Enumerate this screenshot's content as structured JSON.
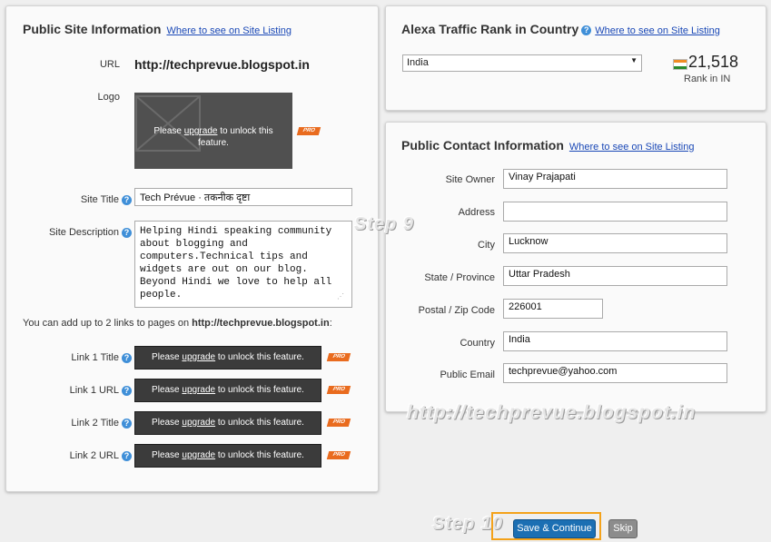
{
  "public_site": {
    "title": "Public Site Information",
    "where_link": "Where to see on Site Listing",
    "url_label": "URL",
    "url_value": "http://techprevue.blogspot.in",
    "logo_label": "Logo",
    "logo_lock_text": "Please upgrade to unlock this feature.",
    "logo_lock_pre": "Please ",
    "logo_lock_link": "upgrade",
    "logo_lock_post": " to unlock this feature.",
    "site_title_label": "Site Title",
    "site_title_value": "Tech Prévue · तकनीक दृष्टा",
    "site_desc_label": "Site Description",
    "site_desc_value": "Helping Hindi speaking community about blogging and computers.Technical tips and widgets are out on our blog. Beyond Hindi we love to help all people.",
    "links_note_pre": "You can add up to 2 links to pages on ",
    "links_note_url": "http://techprevue.blogspot.in",
    "links_note_post": ":",
    "links": [
      {
        "label": "Link 1 Title"
      },
      {
        "label": "Link 1 URL"
      },
      {
        "label": "Link 2 Title"
      },
      {
        "label": "Link 2 URL"
      }
    ],
    "lock_pre": "Please ",
    "lock_link": "upgrade",
    "lock_post": " to unlock this feature.",
    "pro_badge": "PRO"
  },
  "alexa": {
    "title": "Alexa Traffic Rank in Country",
    "where_link": "Where to see on Site Listing",
    "country_selected": "India",
    "rank": "21,518",
    "rank_label": "Rank in IN",
    "flag_icon": "india-flag-icon"
  },
  "contact": {
    "title": "Public Contact Information",
    "where_link": "Where to see on Site Listing",
    "fields": [
      {
        "label": "Site Owner",
        "value": "Vinay Prajapati"
      },
      {
        "label": "Address",
        "value": ""
      },
      {
        "label": "City",
        "value": "Lucknow"
      },
      {
        "label": "State / Province",
        "value": "Uttar Pradesh"
      },
      {
        "label": "Postal / Zip Code",
        "value": "226001"
      },
      {
        "label": "Country",
        "value": "India"
      },
      {
        "label": "Public Email",
        "value": "techprevue@yahoo.com"
      }
    ]
  },
  "watermarks": {
    "step9": "Step 9",
    "step10": "Step 10",
    "url": "http://techprevue.blogspot.in"
  },
  "actions": {
    "save": "Save & Continue",
    "skip": "Skip"
  },
  "colors": {
    "link": "#1a48b6",
    "pro_badge": "#e96b1e",
    "save_button": "#1c6fb3",
    "highlight": "#f4a21a"
  }
}
